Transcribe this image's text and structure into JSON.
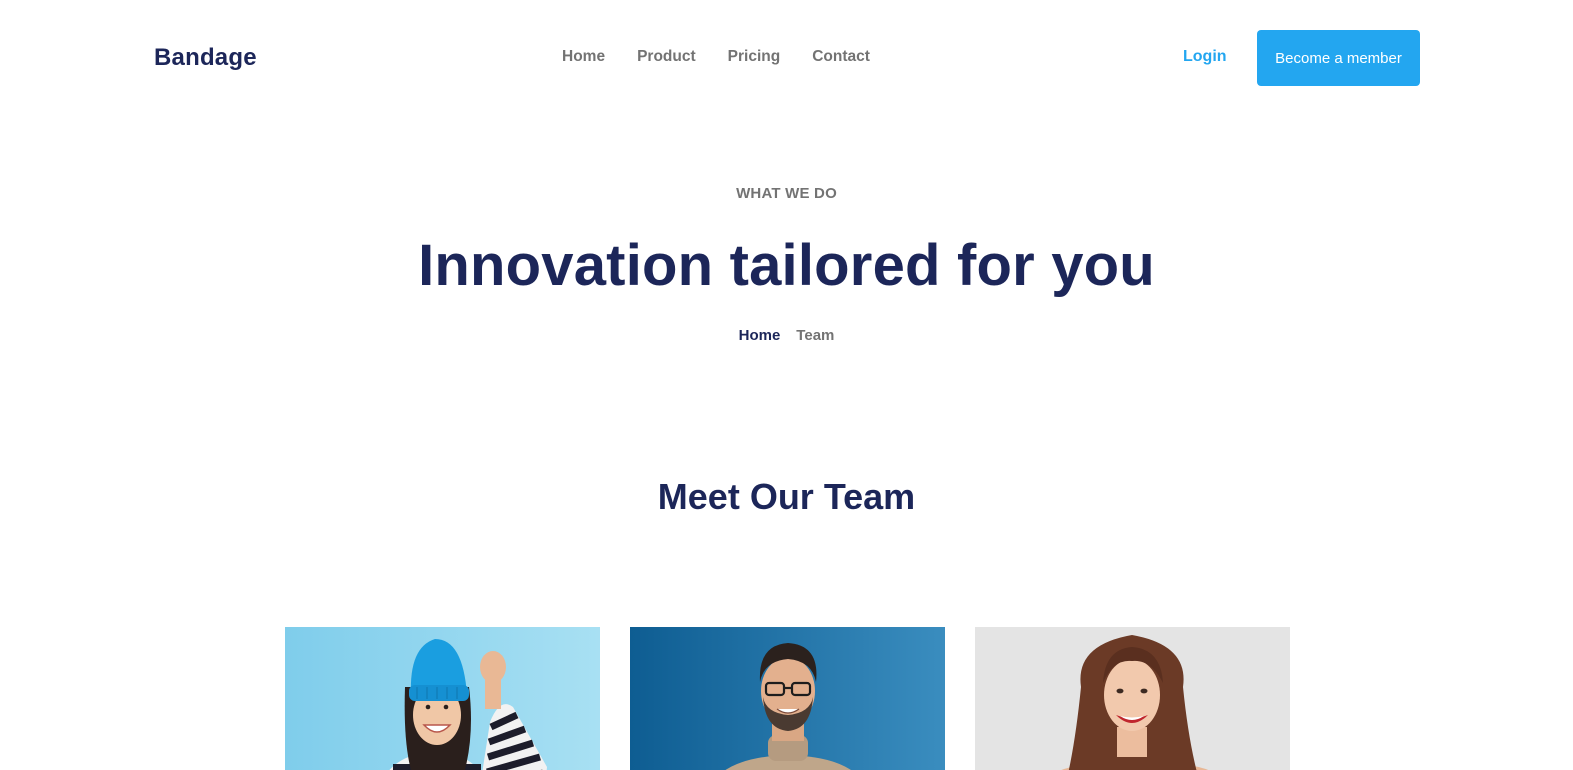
{
  "header": {
    "brand": "Bandage",
    "nav": [
      {
        "label": "Home"
      },
      {
        "label": "Product"
      },
      {
        "label": "Pricing"
      },
      {
        "label": "Contact"
      }
    ],
    "login_label": "Login",
    "cta_label": "Become a member"
  },
  "hero": {
    "eyebrow": "WHAT WE DO",
    "title": "Innovation tailored for you",
    "breadcrumb": {
      "home": "Home",
      "current": "Team"
    }
  },
  "team": {
    "title": "Meet Our Team",
    "members": [
      {
        "photo": "woman-blue-beanie-photo"
      },
      {
        "photo": "man-glasses-photo"
      },
      {
        "photo": "woman-smiling-photo"
      }
    ]
  },
  "colors": {
    "primary": "#23A6F0",
    "heading": "#1c2659",
    "muted": "#737373"
  }
}
